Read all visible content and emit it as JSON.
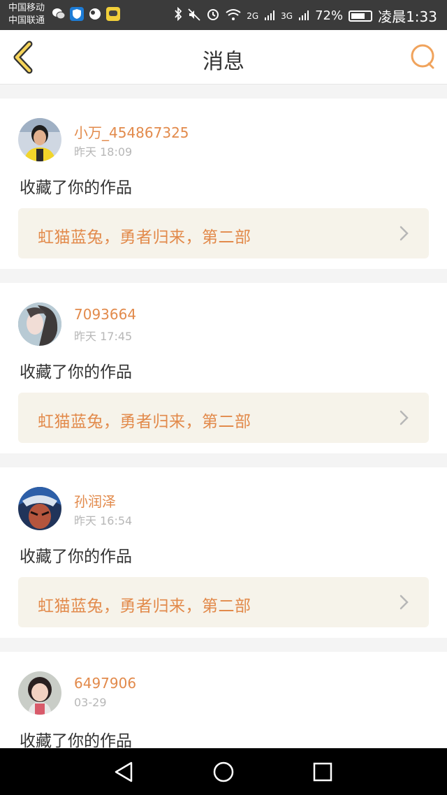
{
  "status_bar": {
    "carrier1": "中国移动",
    "carrier2": "中国联通",
    "net1": "2G",
    "net2": "3G",
    "battery": "72%",
    "battery_level": 0.72,
    "time": "凌晨1:33"
  },
  "header": {
    "title": "消息"
  },
  "messages": [
    {
      "username": "小万_454867325",
      "time": "昨天 18:09",
      "action": "收藏了你的作品",
      "work_title": "虹猫蓝兔，勇者归来，第二部"
    },
    {
      "username": "7093664",
      "time": "昨天 17:45",
      "action": "收藏了你的作品",
      "work_title": "虹猫蓝兔，勇者归来，第二部"
    },
    {
      "username": "孙润泽",
      "time": "昨天 16:54",
      "action": "收藏了你的作品",
      "work_title": "虹猫蓝兔，勇者归来，第二部"
    },
    {
      "username": "6497906",
      "time": "03-29",
      "action": "收藏了你的作品",
      "work_title": ""
    }
  ],
  "colors": {
    "accent": "#e28a4b",
    "back_icon_fill": "#f6d45a"
  },
  "icons": {
    "back": "back-chevron-icon",
    "search": "search-icon",
    "nav_back": "triangle-back-icon",
    "nav_home": "circle-home-icon",
    "nav_recent": "square-recent-icon"
  }
}
